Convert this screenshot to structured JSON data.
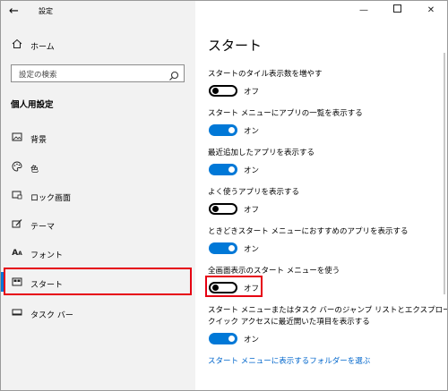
{
  "window": {
    "title": "設定"
  },
  "sidebar": {
    "home_label": "ホーム",
    "search_placeholder": "設定の検索",
    "section_title": "個人用設定",
    "items": [
      {
        "label": "背景",
        "icon": "image-icon"
      },
      {
        "label": "色",
        "icon": "palette-icon"
      },
      {
        "label": "ロック画面",
        "icon": "lock-screen-icon"
      },
      {
        "label": "テーマ",
        "icon": "theme-brush-icon"
      },
      {
        "label": "フォント",
        "icon": "font-icon"
      },
      {
        "label": "スタート",
        "icon": "start-icon",
        "selected": true
      },
      {
        "label": "タスク バー",
        "icon": "taskbar-icon"
      }
    ]
  },
  "main": {
    "title": "スタート",
    "settings": [
      {
        "label": "スタートのタイル表示数を増やす",
        "state": "オフ",
        "on": false
      },
      {
        "label": "スタート メニューにアプリの一覧を表示する",
        "state": "オン",
        "on": true
      },
      {
        "label": "最近追加したアプリを表示する",
        "state": "オン",
        "on": true
      },
      {
        "label": "よく使うアプリを表示する",
        "state": "オフ",
        "on": false
      },
      {
        "label": "ときどきスタート メニューにおすすめのアプリを表示する",
        "state": "オン",
        "on": true
      },
      {
        "label": "全画面表示のスタート メニューを使う",
        "state": "オフ",
        "on": false
      },
      {
        "label_line1": "スタート メニューまたはタスク バーのジャンプ リストとエクスプローラーの",
        "label_line2": "クイック アクセスに最近開いた項目を表示する",
        "state": "オン",
        "on": true
      }
    ],
    "link": "スタート メニューに表示するフォルダーを選ぶ"
  },
  "colors": {
    "accent": "#0078d7",
    "highlight": "#e60012",
    "link": "#0066cc"
  }
}
